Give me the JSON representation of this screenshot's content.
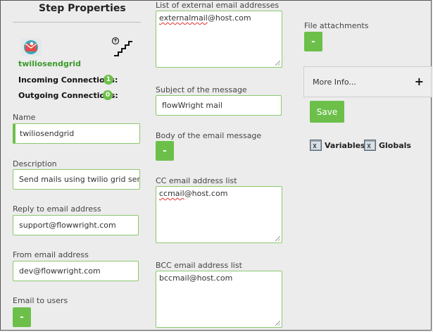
{
  "header": {
    "title": "Step Properties"
  },
  "step": {
    "name": "twiliosendgrid",
    "incoming_label": "Incoming Connections:",
    "incoming_count": "1",
    "outgoing_label": "Outgoing Connections:",
    "outgoing_count": "0",
    "icon": "envelope-icon",
    "step_icon": "step-stairs-icon"
  },
  "fields": {
    "name": {
      "label": "Name",
      "value": "twiliosendgrid"
    },
    "description": {
      "label": "Description",
      "value": "Send mails using twilio grid service"
    },
    "reply_to": {
      "label": "Reply to email address",
      "value": "support@flowwright.com"
    },
    "from": {
      "label": "From email address",
      "value": "dev@flowwright.com"
    },
    "email_to_users": {
      "label": "Email to users",
      "button": "-"
    },
    "external": {
      "label": "List of external email addresses",
      "value_spell": "externalmail",
      "value_rest": "@host.com"
    },
    "subject": {
      "label": "Subject of the message",
      "value": "flowWright mail"
    },
    "body": {
      "label": "Body of the email message",
      "button": "-"
    },
    "cc": {
      "label": "CC email address list",
      "value_spell": "ccmail",
      "value_rest": "@host.com"
    },
    "bcc": {
      "label": "BCC email address list",
      "value": "bccmail@host.com"
    },
    "attachments": {
      "label": "File attachments",
      "button": "-"
    }
  },
  "more_info": {
    "label": "More Info...",
    "icon": "plus-icon"
  },
  "actions": {
    "save": "Save",
    "variables": "Variables",
    "globals": "Globals"
  },
  "colors": {
    "accent": "#6cc04a",
    "border": "#8cc86e",
    "background": "#ececec"
  }
}
